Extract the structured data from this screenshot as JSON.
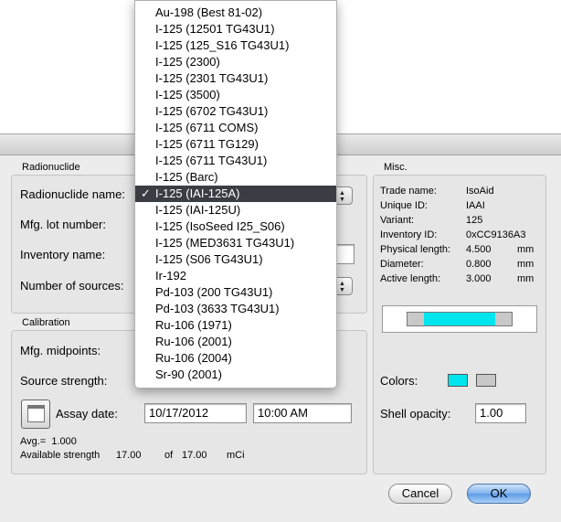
{
  "radionuclide_group": {
    "title": "Radionuclide",
    "radionuclide_label": "Radionuclide name:",
    "lot_label": "Mfg. lot number:",
    "inventory_label": "Inventory name:",
    "sources_label": "Number of sources:"
  },
  "calibration_group": {
    "title": "Calibration",
    "midpoints_label": "Mfg. midpoints:",
    "strength_label": "Source strength:",
    "assay_label": "Assay date:",
    "assay_date": "10/17/2012",
    "assay_time": "10:00 AM",
    "avg_text": "Avg.=  1.000",
    "available_label": "Available strength",
    "available_value": "17.00",
    "of_label": "of",
    "total_value": "17.00",
    "unit": "mCi"
  },
  "misc_group": {
    "title": "Misc.",
    "rows": [
      {
        "label": "Trade name:",
        "value": "IsoAid",
        "unit": ""
      },
      {
        "label": "Unique ID:",
        "value": "IAAI",
        "unit": ""
      },
      {
        "label": "Variant:",
        "value": "125",
        "unit": ""
      },
      {
        "label": "Inventory ID:",
        "value": "0xCC9136A3",
        "unit": ""
      },
      {
        "label": "Physical length:",
        "value": "4.500",
        "unit": "mm"
      },
      {
        "label": "Diameter:",
        "value": "0.800",
        "unit": "mm"
      },
      {
        "label": "Active length:",
        "value": "3.000",
        "unit": "mm"
      }
    ],
    "colors_label": "Colors:",
    "color1": "#00e5ee",
    "color2": "#c8c8c8",
    "opacity_label": "Shell opacity:",
    "opacity_value": "1.00"
  },
  "buttons": {
    "cancel": "Cancel",
    "ok": "OK"
  },
  "dropdown": {
    "selected_index": 10,
    "check": "✓",
    "items": [
      "Au-198 (Best 81-02)",
      "I-125 (12501 TG43U1)",
      "I-125 (125_S16 TG43U1)",
      "I-125 (2300)",
      "I-125 (2301 TG43U1)",
      "I-125 (3500)",
      "I-125 (6702 TG43U1)",
      "I-125 (6711 COMS)",
      "I-125 (6711 TG129)",
      "I-125 (6711 TG43U1)",
      "I-125 (Barc)",
      "I-125 (IAI-125A)",
      "I-125 (IAI-125U)",
      "I-125 (IsoSeed I25_S06)",
      "I-125 (MED3631 TG43U1)",
      "I-125 (S06 TG43U1)",
      "Ir-192",
      "Pd-103 (200 TG43U1)",
      "Pd-103 (3633 TG43U1)",
      "Ru-106 (1971)",
      "Ru-106 (2001)",
      "Ru-106 (2004)",
      "Sr-90 (2001)"
    ]
  }
}
